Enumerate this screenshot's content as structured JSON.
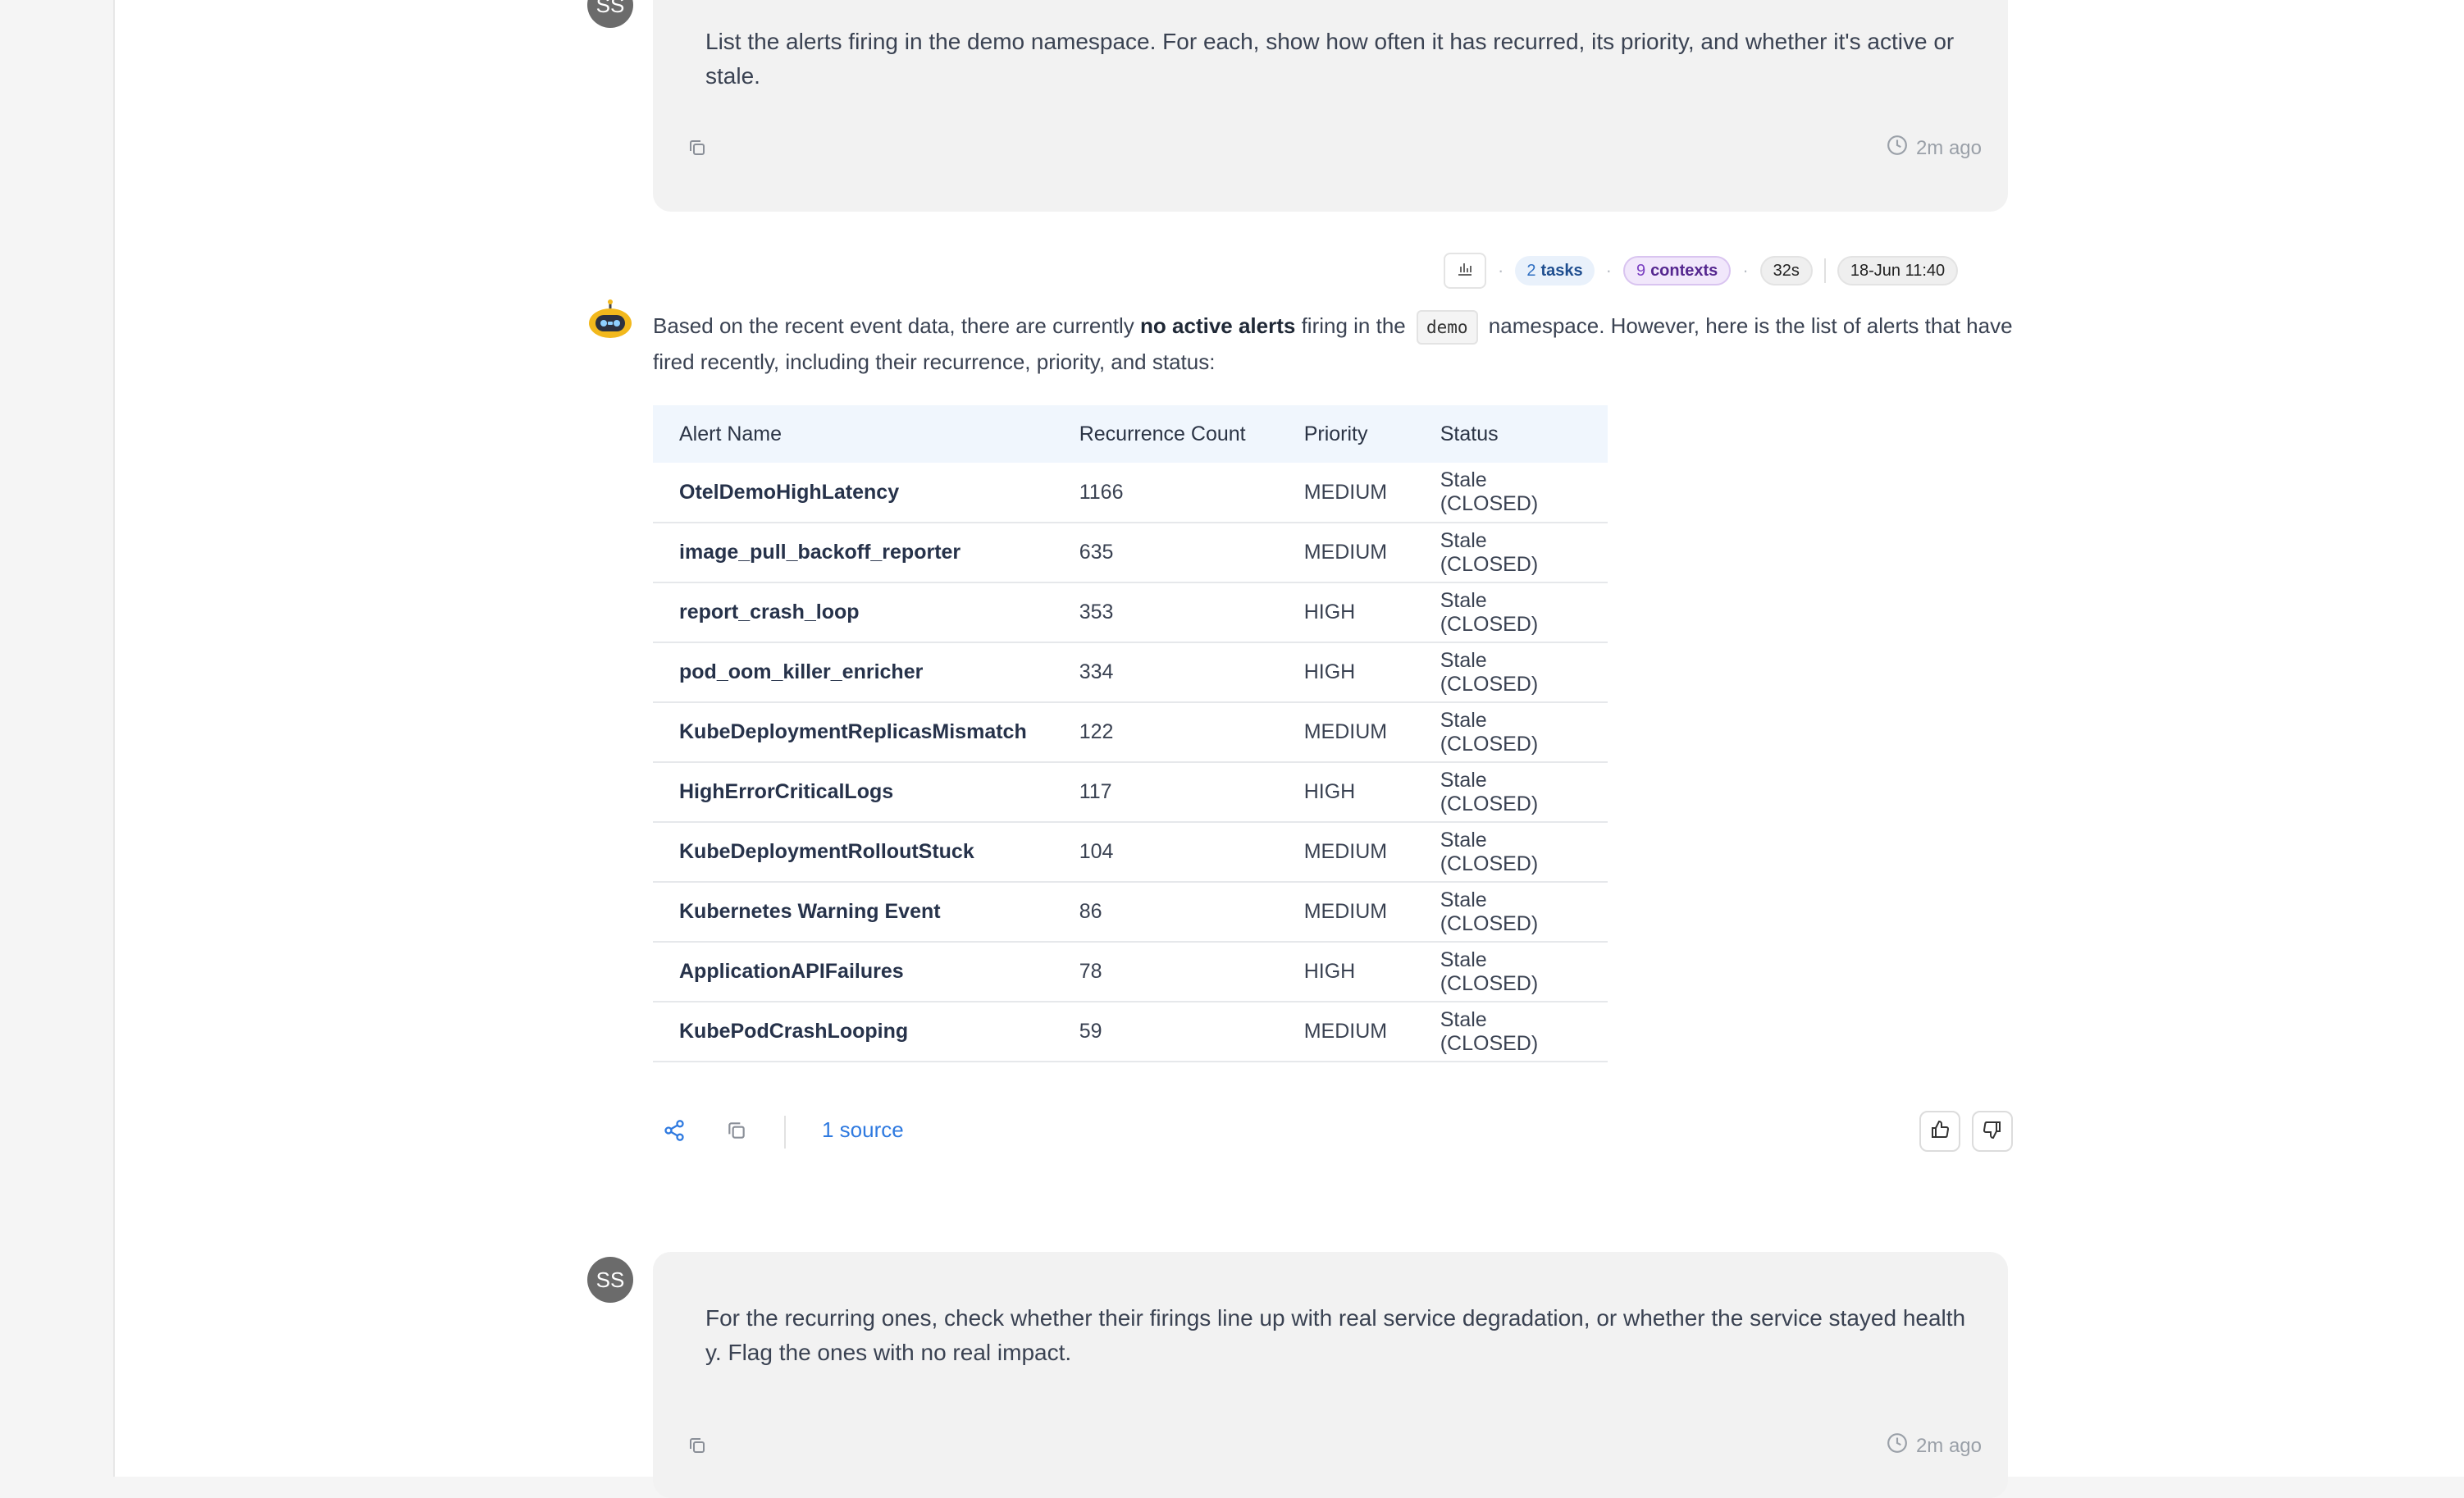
{
  "messages": {
    "user1": {
      "avatar_initials": "SS",
      "text": "List the alerts firing in the demo namespace. For each, show how often it has recurred, its priority, and whether it's active or stale.",
      "time": "2m ago"
    },
    "assistant": {
      "meta": {
        "tasks_count": "2",
        "tasks_label": "tasks",
        "contexts_count": "9",
        "contexts_label": "contexts",
        "duration": "32s",
        "datetime": "18-Jun 11:40"
      },
      "intro_part1": "Based on the recent event data, there are currently ",
      "intro_bold": "no active alerts",
      "intro_part2": " firing in the ",
      "intro_code": "demo",
      "intro_part3": " namespace. However, here is the list of alerts that have fired recently, including their recurrence, priority, and status:",
      "table": {
        "headers": [
          "Alert Name",
          "Recurrence Count",
          "Priority",
          "Status"
        ],
        "rows": [
          [
            "OtelDemoHighLatency",
            "1166",
            "MEDIUM",
            "Stale (CLOSED)"
          ],
          [
            "image_pull_backoff_reporter",
            "635",
            "MEDIUM",
            "Stale (CLOSED)"
          ],
          [
            "report_crash_loop",
            "353",
            "HIGH",
            "Stale (CLOSED)"
          ],
          [
            "pod_oom_killer_enricher",
            "334",
            "HIGH",
            "Stale (CLOSED)"
          ],
          [
            "KubeDeploymentReplicasMismatch",
            "122",
            "MEDIUM",
            "Stale (CLOSED)"
          ],
          [
            "HighErrorCriticalLogs",
            "117",
            "HIGH",
            "Stale (CLOSED)"
          ],
          [
            "KubeDeploymentRolloutStuck",
            "104",
            "MEDIUM",
            "Stale (CLOSED)"
          ],
          [
            "Kubernetes Warning Event",
            "86",
            "MEDIUM",
            "Stale (CLOSED)"
          ],
          [
            "ApplicationAPIFailures",
            "78",
            "HIGH",
            "Stale (CLOSED)"
          ],
          [
            "KubePodCrashLooping",
            "59",
            "MEDIUM",
            "Stale (CLOSED)"
          ]
        ]
      },
      "sources_label": "1 source"
    },
    "user2": {
      "avatar_initials": "SS",
      "text": "For the recurring ones, check whether their firings line up with real service degradation, or whether the service stayed healthy. Flag the ones with no real impact.",
      "time": "2m ago"
    }
  },
  "icons": {
    "copy": "copy-icon",
    "clock": "clock-icon",
    "chart": "bar-chart-icon",
    "share": "share-icon",
    "thumbs_up": "thumbs-up-icon",
    "thumbs_down": "thumbs-down-icon",
    "bot": "robot-avatar-icon"
  },
  "colors": {
    "link": "#2f7ae0",
    "user_bubble": "#f2f2f2",
    "table_header": "#f0f6fd"
  }
}
